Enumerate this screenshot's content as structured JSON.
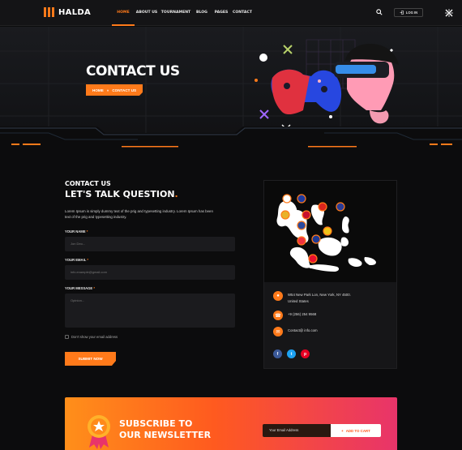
{
  "header": {
    "logo_text": "HALDA",
    "nav": [
      {
        "label": "HOME",
        "active": true
      },
      {
        "label": "ABOUT US",
        "active": false
      },
      {
        "label": "TOURNAMENT",
        "active": false
      },
      {
        "label": "BLOG",
        "active": false
      },
      {
        "label": "PAGES",
        "active": false
      },
      {
        "label": "CONTACT",
        "active": false
      }
    ],
    "login_label": "LOG IN",
    "accent": "#ff7a1a"
  },
  "hero": {
    "title": "CONTACT US",
    "breadcrumb": {
      "home": "HOME",
      "separator": "»",
      "current": "CONTACT US"
    }
  },
  "contact": {
    "eyebrow": "CONTACT US",
    "heading": "LET'S TALK QUESTION",
    "heading_dot": ".",
    "description": "Lorem Ipsum is simply dummy text of the prig and typesetting industry. Lorem Ipsum has been text of the prig and typesetting industry.",
    "form": {
      "name_label": "YOUR NAME",
      "name_placeholder": "Jon Deo...",
      "email_label": "YOUR EMAIL",
      "email_placeholder": "info.example@gmail.com",
      "message_label": "YOUR MESSAGE",
      "message_placeholder": "Opinion...",
      "required_mark": "*",
      "checkbox_label": "Don't show your email address",
      "submit_label": "SUBMIT NOW"
    }
  },
  "info": {
    "address_line1": "W54 New Park Lon, New York, NY 4500.",
    "address_line2": "United States",
    "phone": "+9 (256) 254 9568",
    "email": "Contact@ info.com",
    "icons": [
      "location-icon",
      "phone-icon",
      "mail-icon"
    ],
    "socials": [
      {
        "name": "facebook",
        "glyph": "f",
        "color": "#3b5998"
      },
      {
        "name": "twitter",
        "glyph": "t",
        "color": "#1da1f2"
      },
      {
        "name": "pinterest",
        "glyph": "p",
        "color": "#e60023"
      }
    ]
  },
  "newsletter": {
    "title": "SUBSCRIBE TO OUR NEWSLETTER",
    "input_placeholder": "Your Email Address",
    "button_label": "ADD TO CART",
    "button_glyph": "+"
  }
}
